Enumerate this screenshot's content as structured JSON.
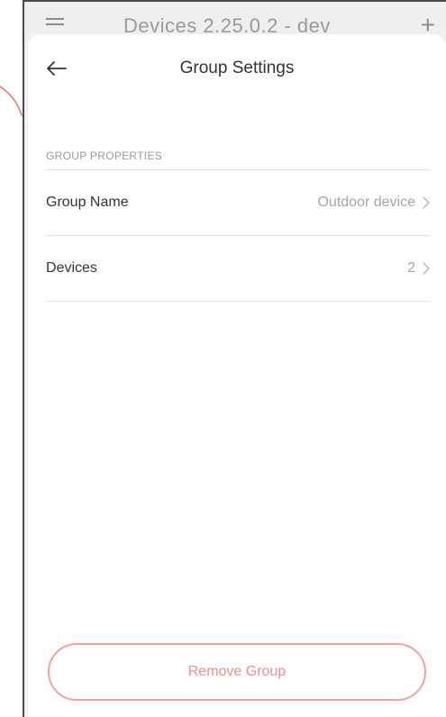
{
  "background_app": {
    "title": "Devices 2.25.0.2 - dev",
    "menu_icon": "menu-icon",
    "add_icon": "plus-icon"
  },
  "header": {
    "title": "Group Settings",
    "back_icon": "arrow-left-icon"
  },
  "section": {
    "label": "GROUP PROPERTIES"
  },
  "rows": [
    {
      "label": "Group Name",
      "value": "Outdoor device",
      "icon": "chevron-right-icon"
    },
    {
      "label": "Devices",
      "value": "2",
      "icon": "chevron-right-icon"
    }
  ],
  "actions": {
    "remove_label": "Remove Group"
  },
  "colors": {
    "accent": "#f28e8e",
    "accent_border": "#f5a0a0",
    "text_primary": "#333333",
    "text_secondary": "#a5a5a5",
    "divider": "#e3e3e3"
  }
}
